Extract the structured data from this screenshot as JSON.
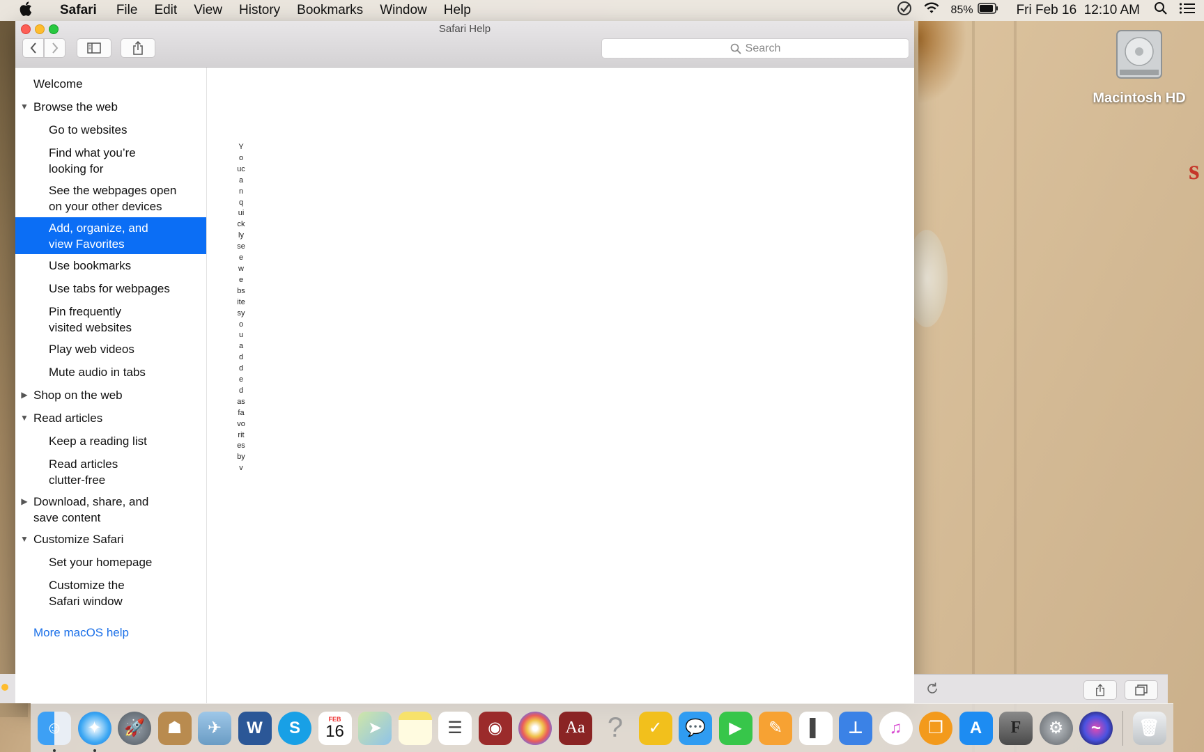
{
  "menubar": {
    "app_name": "Safari",
    "items": [
      "File",
      "Edit",
      "View",
      "History",
      "Bookmarks",
      "Window",
      "Help"
    ],
    "battery": "85%",
    "clock": "Fri Feb 16  12:10 AM"
  },
  "window": {
    "title": "Safari Help",
    "search_placeholder": "Search"
  },
  "sidebar": {
    "items": [
      {
        "label": "Welcome",
        "level": 1,
        "expander": ""
      },
      {
        "label": "Browse the web",
        "level": 1,
        "expander": "open"
      },
      {
        "label": "Go to websites",
        "level": 2,
        "expander": ""
      },
      {
        "label": "Find what you’re\nlooking for",
        "level": 2,
        "expander": ""
      },
      {
        "label": "See the webpages open\non your other devices",
        "level": 2,
        "expander": ""
      },
      {
        "label": "Add, organize, and\nview Favorites",
        "level": 2,
        "expander": "",
        "selected": true
      },
      {
        "label": "Use bookmarks",
        "level": 2,
        "expander": ""
      },
      {
        "label": "Use tabs for webpages",
        "level": 2,
        "expander": ""
      },
      {
        "label": "Pin frequently\nvisited websites",
        "level": 2,
        "expander": ""
      },
      {
        "label": "Play web videos",
        "level": 2,
        "expander": ""
      },
      {
        "label": "Mute audio in tabs",
        "level": 2,
        "expander": ""
      },
      {
        "label": "Shop on the web",
        "level": 1,
        "expander": "closed"
      },
      {
        "label": "Read articles",
        "level": 1,
        "expander": "open"
      },
      {
        "label": "Keep a reading list",
        "level": 2,
        "expander": ""
      },
      {
        "label": "Read articles\nclutter-free",
        "level": 2,
        "expander": ""
      },
      {
        "label": "Download, share, and\nsave content",
        "level": 1,
        "expander": "closed"
      },
      {
        "label": "Customize Safari",
        "level": 1,
        "expander": "open"
      },
      {
        "label": "Set your homepage",
        "level": 2,
        "expander": ""
      },
      {
        "label": "Customize the\nSafari window",
        "level": 2,
        "expander": ""
      }
    ],
    "more_help": "More macOS help"
  },
  "content": {
    "vertical_text": "Youcanquicklyseewebsitesyouaddedasfavoritesbyv"
  },
  "desktop": {
    "drive_label": "Macintosh HD"
  },
  "dock": {
    "apps": [
      {
        "name": "Finder",
        "running": true
      },
      {
        "name": "Safari",
        "running": true
      },
      {
        "name": "Launchpad",
        "running": false
      },
      {
        "name": "Contacts",
        "running": false
      },
      {
        "name": "Preview",
        "running": false
      },
      {
        "name": "Word",
        "running": false
      },
      {
        "name": "Skype",
        "running": false
      },
      {
        "name": "Calendar",
        "running": false
      },
      {
        "name": "Maps",
        "running": false
      },
      {
        "name": "Notes",
        "running": false
      },
      {
        "name": "Reminders",
        "running": false
      },
      {
        "name": "Photo Booth",
        "running": false
      },
      {
        "name": "Photos",
        "running": false
      },
      {
        "name": "Dictionary",
        "running": false
      },
      {
        "name": "Help",
        "running": false
      },
      {
        "name": "Norton",
        "running": false
      },
      {
        "name": "Messages",
        "running": false
      },
      {
        "name": "FaceTime",
        "running": false
      },
      {
        "name": "Pages",
        "running": false
      },
      {
        "name": "Numbers",
        "running": false
      },
      {
        "name": "Keynote",
        "running": false
      },
      {
        "name": "iTunes",
        "running": false
      },
      {
        "name": "iBooks",
        "running": false
      },
      {
        "name": "App Store",
        "running": false
      },
      {
        "name": "Font Book",
        "running": false
      },
      {
        "name": "System Preferences",
        "running": false
      },
      {
        "name": "Siri",
        "running": false
      },
      {
        "name": "Trash",
        "running": false
      }
    ],
    "calendar_month": "FEB",
    "calendar_day": "16",
    "dictionary_glyph": "Aa",
    "word_glyph": "W",
    "skype_glyph": "S",
    "fontbook_glyph": "F"
  }
}
